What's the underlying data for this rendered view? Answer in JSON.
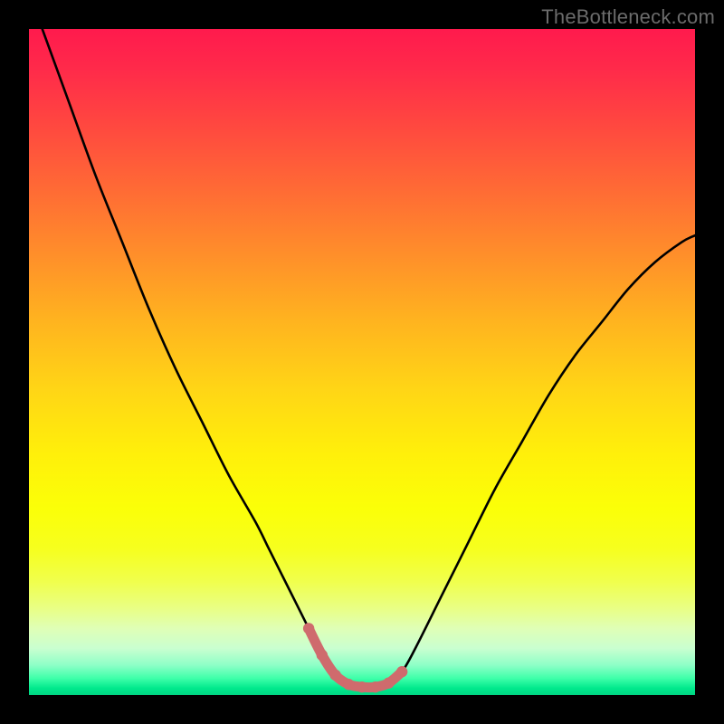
{
  "watermark": "TheBottleneck.com",
  "chart_data": {
    "type": "line",
    "title": "",
    "xlabel": "",
    "ylabel": "",
    "xlim": [
      0,
      100
    ],
    "ylim": [
      0,
      100
    ],
    "grid": false,
    "legend": false,
    "series": [
      {
        "name": "bottleneck-curve",
        "color": "#000000",
        "x": [
          2,
          6,
          10,
          14,
          18,
          22,
          26,
          30,
          34,
          36,
          38,
          40,
          42,
          44,
          46,
          48,
          50,
          52,
          54,
          56,
          58,
          62,
          66,
          70,
          74,
          78,
          82,
          86,
          90,
          94,
          98,
          100
        ],
        "values": [
          100,
          89,
          78,
          68,
          58,
          49,
          41,
          33,
          26,
          22,
          18,
          14,
          10,
          6,
          3,
          1.6,
          1.2,
          1.2,
          1.8,
          3.5,
          7,
          15,
          23,
          31,
          38,
          45,
          51,
          56,
          61,
          65,
          68,
          69
        ]
      },
      {
        "name": "optimal-region-highlight",
        "color": "#cf6b6d",
        "x": [
          42,
          44,
          46,
          48,
          50,
          52,
          54,
          56
        ],
        "values": [
          10,
          6,
          3,
          1.6,
          1.2,
          1.2,
          1.8,
          3.5
        ]
      }
    ],
    "annotations": []
  }
}
